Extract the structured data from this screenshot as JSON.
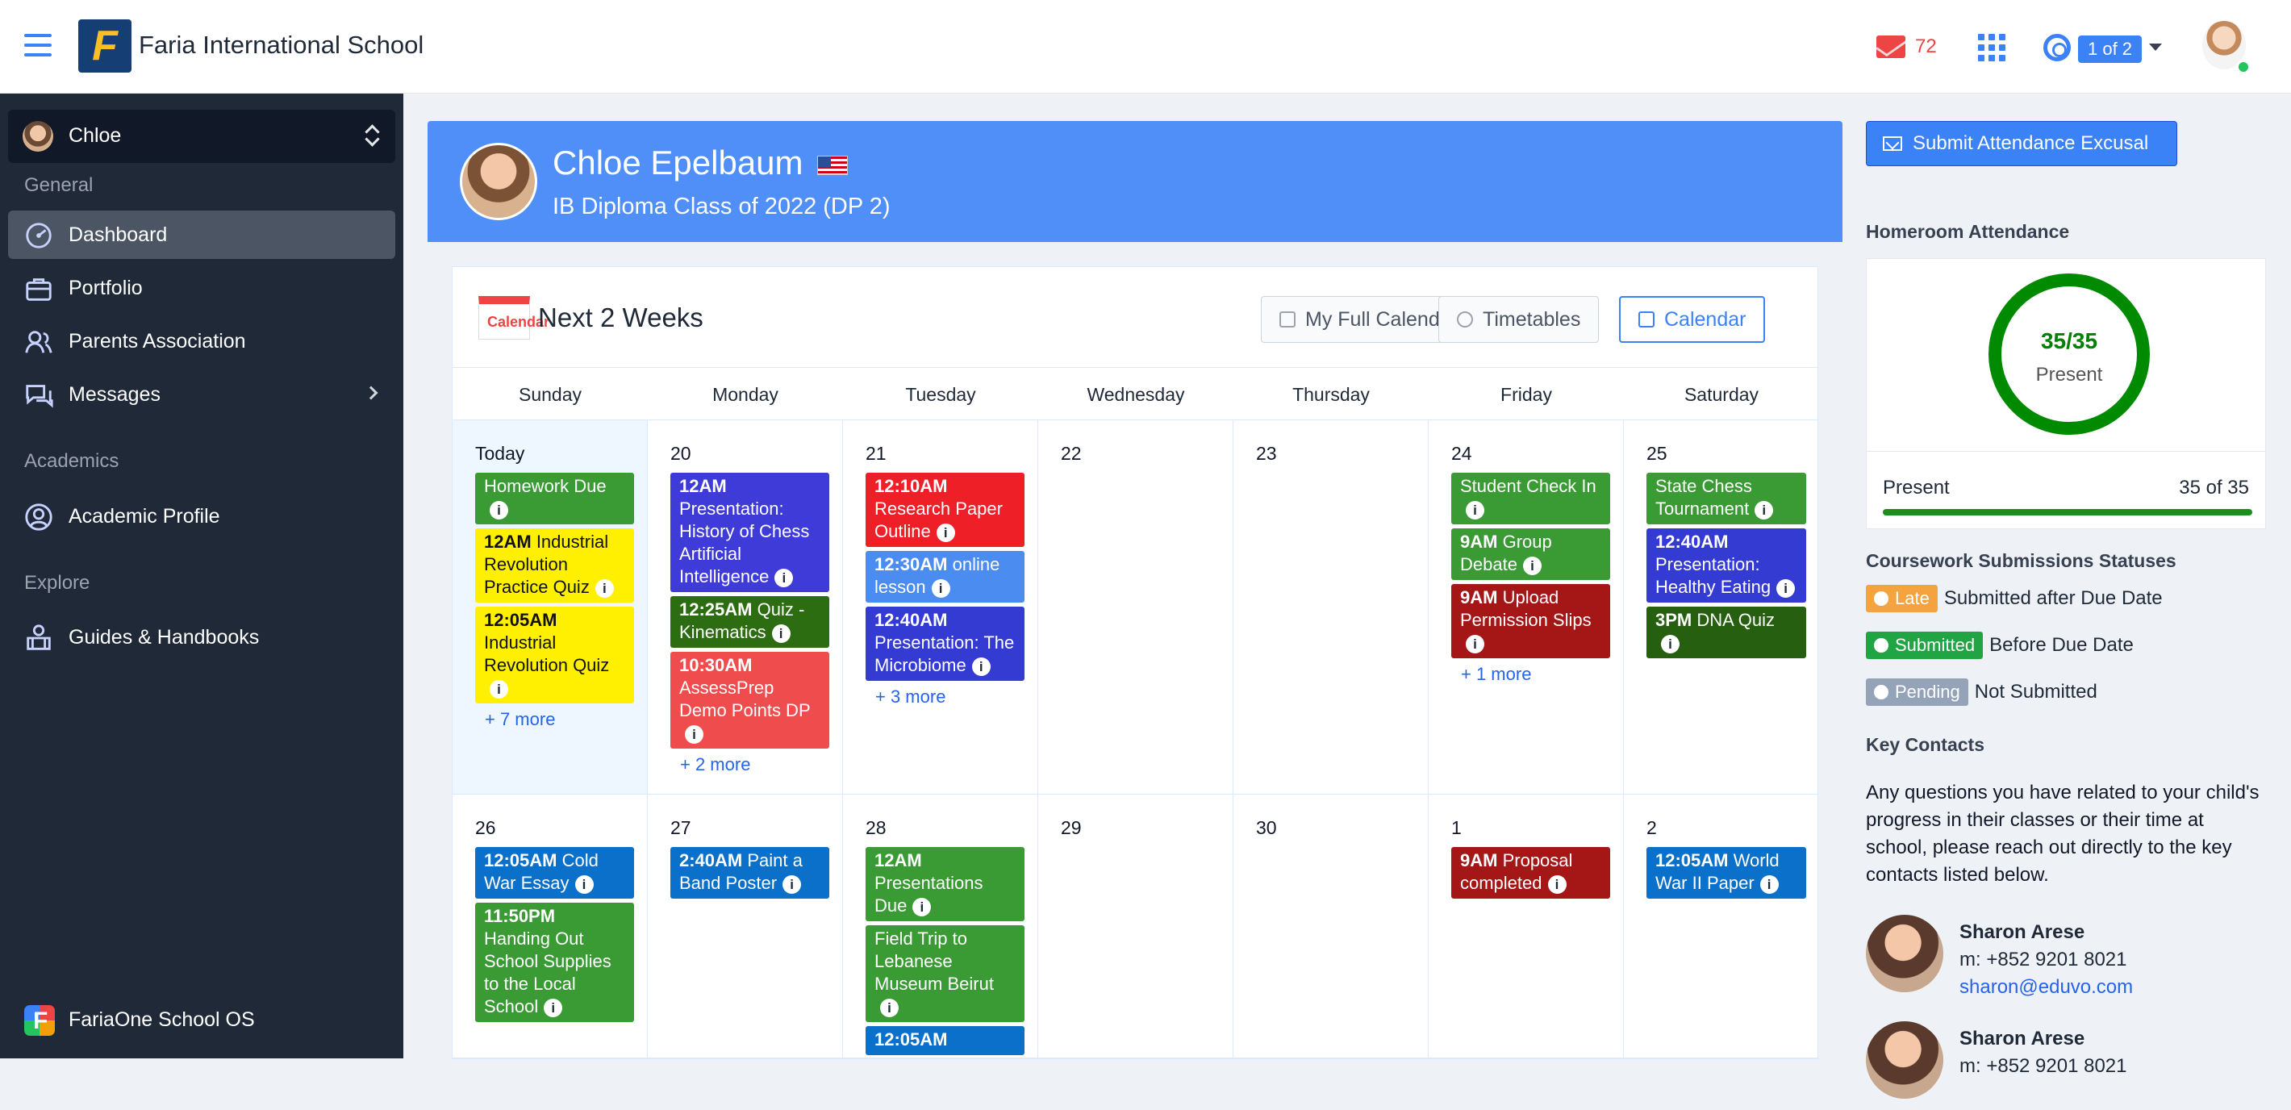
{
  "top": {
    "school_name": "Faria International School",
    "message_count": "72",
    "pager": "1 of 2"
  },
  "sidebar": {
    "student": "Chloe",
    "sections": {
      "general": "General",
      "academics": "Academics",
      "explore": "Explore"
    },
    "items": [
      {
        "label": "Dashboard"
      },
      {
        "label": "Portfolio"
      },
      {
        "label": "Parents Association"
      },
      {
        "label": "Messages"
      },
      {
        "label": "Academic Profile"
      },
      {
        "label": "Guides & Handbooks"
      }
    ],
    "footer": "FariaOne School OS"
  },
  "hero": {
    "name": "Chloe Epelbaum",
    "subtitle": "IB Diploma Class of 2022 (DP 2)"
  },
  "calendar": {
    "icon_text": "Calendar",
    "title": "Next 2 Weeks",
    "buttons": {
      "full": "My Full Calendar",
      "timetables": "Timetables",
      "calendar": "Calendar"
    },
    "weekdays": [
      "Sunday",
      "Monday",
      "Tuesday",
      "Wednesday",
      "Thursday",
      "Friday",
      "Saturday"
    ],
    "days": [
      {
        "label": "Today",
        "today": true,
        "events": [
          {
            "time": "",
            "text": "Homework Due",
            "color": "green"
          },
          {
            "time": "12AM",
            "text": "Industrial Revolution Practice Quiz",
            "color": "yellow"
          },
          {
            "time": "12:05AM",
            "text": "Industrial Revolution Quiz",
            "color": "yellow"
          }
        ],
        "more": "+ 7 more"
      },
      {
        "label": "20",
        "events": [
          {
            "time": "12AM",
            "text": "Presentation: History of Chess Artificial Intelligence",
            "color": "blue"
          },
          {
            "time": "12:25AM",
            "text": "Quiz - Kinematics",
            "color": "darkgreen"
          },
          {
            "time": "10:30AM",
            "text": "AssessPrep Demo Points DP",
            "color": "coral"
          }
        ],
        "more": "+ 2 more"
      },
      {
        "label": "21",
        "events": [
          {
            "time": "12:10AM",
            "text": "Research Paper Outline",
            "color": "red"
          },
          {
            "time": "12:30AM",
            "text": "online lesson",
            "color": "skyblue"
          },
          {
            "time": "12:40AM",
            "text": "Presentation: The Microbiome",
            "color": "navy"
          }
        ],
        "more": "+ 3 more"
      },
      {
        "label": "22",
        "events": []
      },
      {
        "label": "23",
        "events": []
      },
      {
        "label": "24",
        "events": [
          {
            "time": "",
            "text": "Student Check In",
            "color": "green"
          },
          {
            "time": "9AM",
            "text": "Group Debate",
            "color": "green"
          },
          {
            "time": "9AM",
            "text": "Upload Permission Slips",
            "color": "maroon"
          }
        ],
        "more": "+ 1 more"
      },
      {
        "label": "25",
        "events": [
          {
            "time": "",
            "text": "State Chess Tournament",
            "color": "green"
          },
          {
            "time": "12:40AM",
            "text": "Presentation: Healthy Eating",
            "color": "navy"
          },
          {
            "time": "3PM",
            "text": "DNA Quiz",
            "color": "forest"
          }
        ]
      },
      {
        "label": "26",
        "events": [
          {
            "time": "12:05AM",
            "text": "Cold War Essay",
            "color": "royal"
          },
          {
            "time": "11:50PM",
            "text": "Handing Out School Supplies to the Local School",
            "color": "green"
          }
        ]
      },
      {
        "label": "27",
        "events": [
          {
            "time": "2:40AM",
            "text": "Paint a Band Poster",
            "color": "royal"
          }
        ]
      },
      {
        "label": "28",
        "events": [
          {
            "time": "12AM",
            "text": "Presentations Due",
            "color": "green"
          },
          {
            "time": "",
            "text": "Field Trip to Lebanese Museum Beirut",
            "color": "green"
          },
          {
            "time": "12:05AM",
            "text": "",
            "color": "royal"
          }
        ]
      },
      {
        "label": "29",
        "events": []
      },
      {
        "label": "30",
        "events": []
      },
      {
        "label": "1",
        "events": [
          {
            "time": "9AM",
            "text": "Proposal completed",
            "color": "maroon"
          }
        ]
      },
      {
        "label": "2",
        "events": [
          {
            "time": "12:05AM",
            "text": "World War II Paper",
            "color": "royal"
          }
        ]
      }
    ]
  },
  "right": {
    "submit": "Submit Attendance Excusal",
    "attendance_title": "Homeroom Attendance",
    "attendance": {
      "fraction": "35/35",
      "status": "Present",
      "label": "Present",
      "value": "35 of 35",
      "fill": 1
    },
    "coursework_title": "Coursework Submissions Statuses",
    "statuses": [
      {
        "badge": "Late",
        "text": "Submitted after Due Date",
        "kind": "late"
      },
      {
        "badge": "Submitted",
        "text": "Before Due Date",
        "kind": "submitted"
      },
      {
        "badge": "Pending",
        "text": "Not Submitted",
        "kind": "pending"
      }
    ],
    "contacts_title": "Key Contacts",
    "contacts_description": "Any questions you have related to your child's progress in their classes or their time at school, please reach out directly to the key contacts listed below.",
    "contacts": [
      {
        "name": "Sharon Arese",
        "phone": "m: +852 9201 8021",
        "email": "sharon@eduvo.com"
      },
      {
        "name": "Sharon Arese",
        "phone": "m: +852 9201 8021",
        "email": ""
      }
    ]
  }
}
